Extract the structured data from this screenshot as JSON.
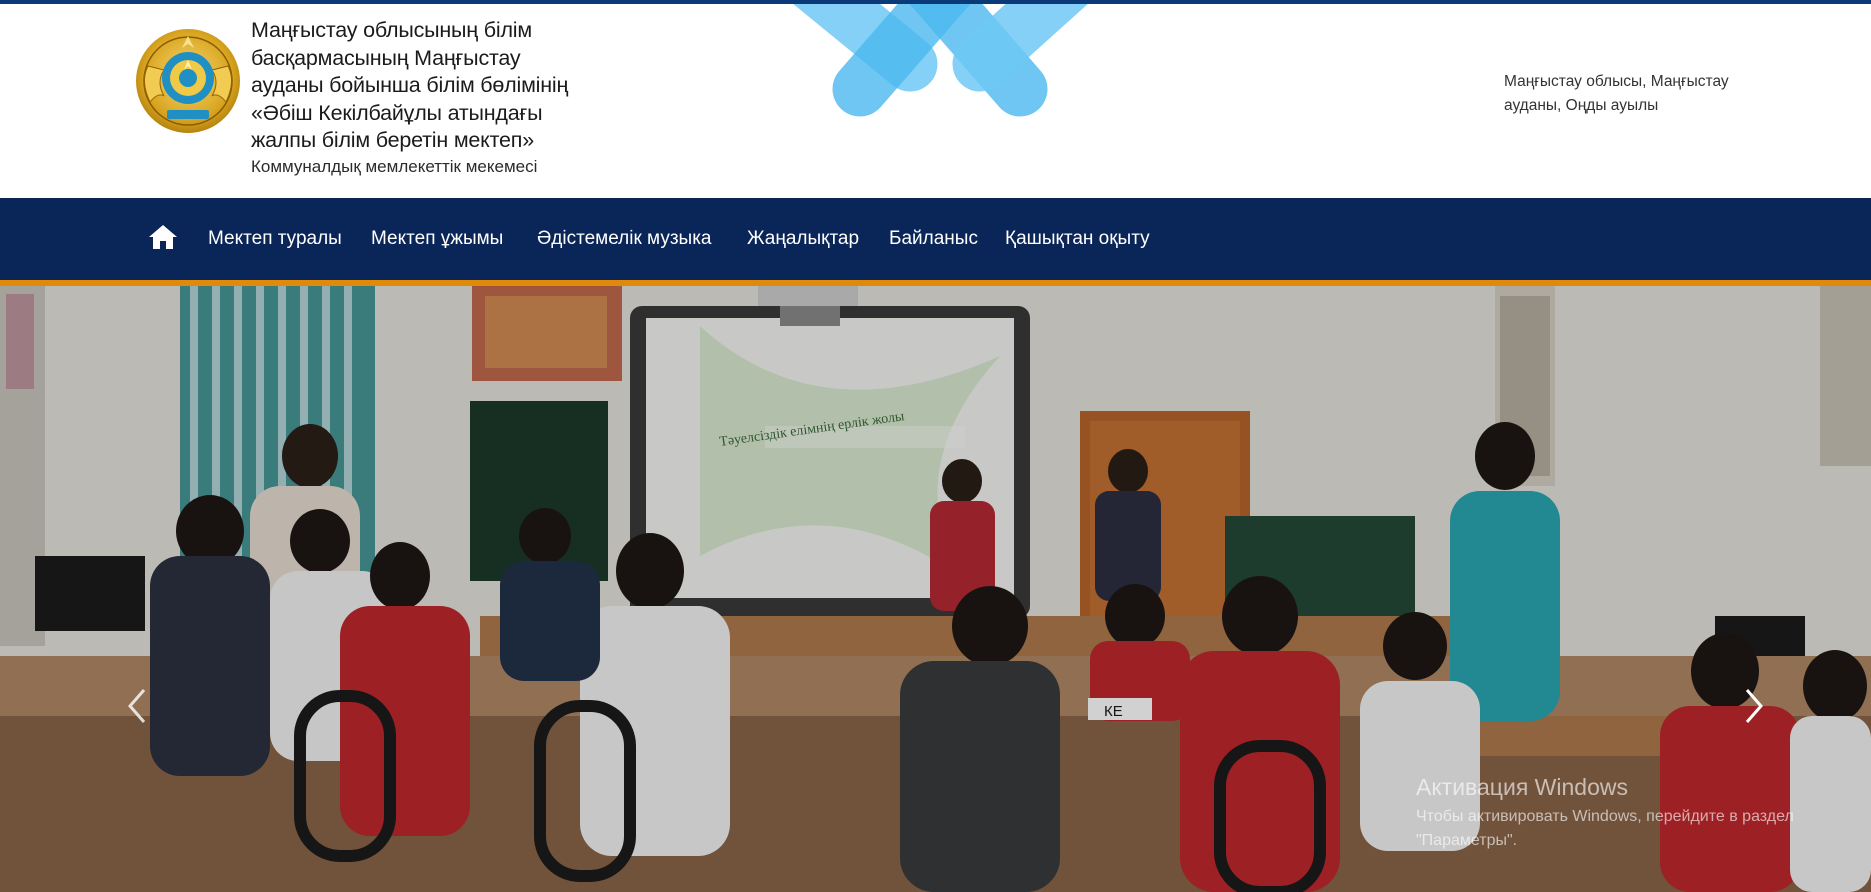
{
  "header": {
    "title": "Маңғыстау облысының білім\nбасқармасының Маңғыстау\nауданы бойынша білім бөлімінің\n«Әбіш Кекілбайұлы атындағы\nжалпы білім беретін мектеп»",
    "subtitle": "Коммуналдық мемлекеттік мекемесі",
    "address": "Маңғыстау облысы, Маңғыстау\nауданы, Оңды ауылы",
    "emblem_icon": "kazakhstan-emblem-icon"
  },
  "nav": {
    "home_icon": "home-icon",
    "items": [
      {
        "label": "Мектеп туралы"
      },
      {
        "label": "Мектеп ұжымы"
      },
      {
        "label": "Әдістемелік музыка"
      },
      {
        "label": "Жаңалықтар"
      },
      {
        "label": "Байланыс"
      },
      {
        "label": "Қашықтан оқыту"
      }
    ]
  },
  "hero": {
    "board_text": "Тәуелсіздік елімнің ерлік жолы",
    "prev_icon": "chevron-left-icon",
    "next_icon": "chevron-right-icon",
    "sign_text": "КЕ"
  },
  "watermark": {
    "title": "Активация Windows",
    "subtitle": "Чтобы активировать Windows, перейдите в раздел\n\"Параметры\"."
  },
  "colors": {
    "top_stripe": "#0b3a78",
    "nav_background": "#0a2558",
    "nav_underline": "#e08a0b",
    "logo_blue": "#5bbef0"
  }
}
